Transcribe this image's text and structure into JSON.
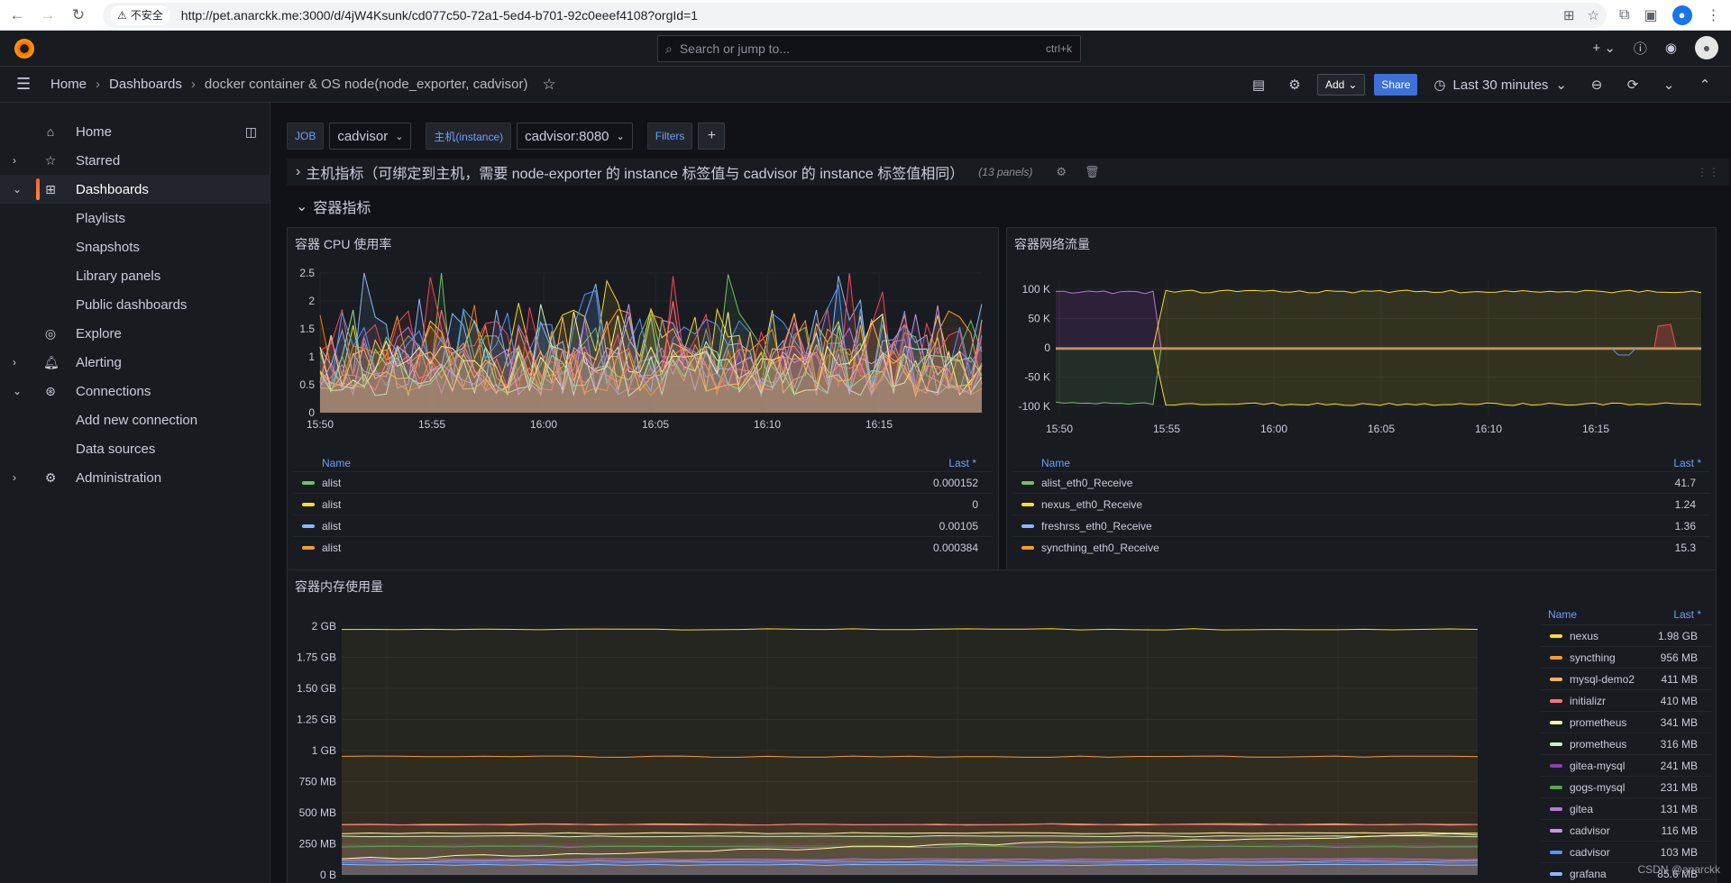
{
  "browser": {
    "insecure_label": "不安全",
    "url": "http://pet.anarckk.me:3000/d/4jW4Ksunk/cd077c50-72a1-5ed4-b701-92c0eeef4108?orgId=1"
  },
  "topbar": {
    "search_placeholder": "Search or jump to...",
    "search_shortcut": "ctrl+k"
  },
  "breadcrumb": {
    "home": "Home",
    "dashboards": "Dashboards",
    "current": "docker container & OS node(node_exporter, cadvisor)"
  },
  "toolbar": {
    "add_label": "Add",
    "share_label": "Share",
    "time_range": "Last 30 minutes"
  },
  "sidebar": {
    "items": [
      {
        "label": "Home",
        "icon": "home-icon",
        "chevron": ""
      },
      {
        "label": "Starred",
        "icon": "star-icon",
        "chevron": "›"
      },
      {
        "label": "Dashboards",
        "icon": "apps-icon",
        "chevron": "⌄"
      },
      {
        "label": "Playlists"
      },
      {
        "label": "Snapshots"
      },
      {
        "label": "Library panels"
      },
      {
        "label": "Public dashboards"
      },
      {
        "label": "Explore",
        "icon": "compass-icon",
        "chevron": ""
      },
      {
        "label": "Alerting",
        "icon": "bell-icon",
        "chevron": "›"
      },
      {
        "label": "Connections",
        "icon": "connections-icon",
        "chevron": "⌄"
      },
      {
        "label": "Add new connection"
      },
      {
        "label": "Data sources"
      },
      {
        "label": "Administration",
        "icon": "gear-icon",
        "chevron": "›"
      }
    ]
  },
  "variables": {
    "job_label": "JOB",
    "job_value": "cadvisor",
    "instance_label": "主机(instance)",
    "instance_value": "cadvisor:8080",
    "filters_label": "Filters"
  },
  "rows": {
    "collapsed_title": "主机指标（可绑定到主机，需要 node-exporter 的 instance 标签值与 cadvisor 的 instance 标签值相同）",
    "collapsed_count": "(13 panels)",
    "expanded_title": "容器指标"
  },
  "panels": {
    "cpu": {
      "title": "容器 CPU 使用率",
      "legend_name": "Name",
      "legend_last": "Last *",
      "legend": [
        {
          "name": "alist",
          "value": "0.000152",
          "color": "#73bf69"
        },
        {
          "name": "alist",
          "value": "0",
          "color": "#fade2a"
        },
        {
          "name": "alist",
          "value": "0.00105",
          "color": "#8ab8ff"
        },
        {
          "name": "alist",
          "value": "0.000384",
          "color": "#ff9830"
        }
      ],
      "y_ticks": [
        "2.5",
        "2",
        "1.5",
        "1",
        "0.5",
        "0"
      ],
      "x_ticks": [
        "15:50",
        "15:55",
        "16:00",
        "16:05",
        "16:10",
        "16:15"
      ]
    },
    "net": {
      "title": "容器网络流量",
      "legend_name": "Name",
      "legend_last": "Last *",
      "legend": [
        {
          "name": "alist_eth0_Receive",
          "value": "41.7",
          "color": "#73bf69"
        },
        {
          "name": "nexus_eth0_Receive",
          "value": "1.24",
          "color": "#fade2a"
        },
        {
          "name": "freshrss_eth0_Receive",
          "value": "1.36",
          "color": "#8ab8ff"
        },
        {
          "name": "syncthing_eth0_Receive",
          "value": "15.3",
          "color": "#ff9830"
        }
      ],
      "y_ticks": [
        "100 K",
        "50 K",
        "0",
        "-50 K",
        "-100 K"
      ],
      "x_ticks": [
        "15:50",
        "15:55",
        "16:00",
        "16:05",
        "16:10",
        "16:15"
      ]
    },
    "mem": {
      "title": "容器内存使用量",
      "legend_name": "Name",
      "legend_last": "Last *",
      "legend": [
        {
          "name": "nexus",
          "value": "1.98 GB",
          "color": "#fade2a"
        },
        {
          "name": "syncthing",
          "value": "956 MB",
          "color": "#ff9830"
        },
        {
          "name": "mysql-demo2",
          "value": "411 MB",
          "color": "#ffb357"
        },
        {
          "name": "initializr",
          "value": "410 MB",
          "color": "#ff7383"
        },
        {
          "name": "prometheus",
          "value": "341 MB",
          "color": "#fff899"
        },
        {
          "name": "prometheus",
          "value": "316 MB",
          "color": "#c8f2c2"
        },
        {
          "name": "gitea-mysql",
          "value": "241 MB",
          "color": "#8f3bb8"
        },
        {
          "name": "gogs-mysql",
          "value": "231 MB",
          "color": "#56a64b"
        },
        {
          "name": "gitea",
          "value": "131 MB",
          "color": "#b877d9"
        },
        {
          "name": "cadvisor",
          "value": "116 MB",
          "color": "#ca95e5"
        },
        {
          "name": "cadvisor",
          "value": "103 MB",
          "color": "#5794f2"
        },
        {
          "name": "grafana",
          "value": "85.6 MB",
          "color": "#8ab8ff"
        }
      ],
      "y_ticks": [
        "2 GB",
        "1.75 GB",
        "1.50 GB",
        "1.25 GB",
        "1 GB",
        "750 MB",
        "500 MB",
        "250 MB",
        "0 B"
      ]
    }
  },
  "watermark": "CSDN @anarckk"
}
